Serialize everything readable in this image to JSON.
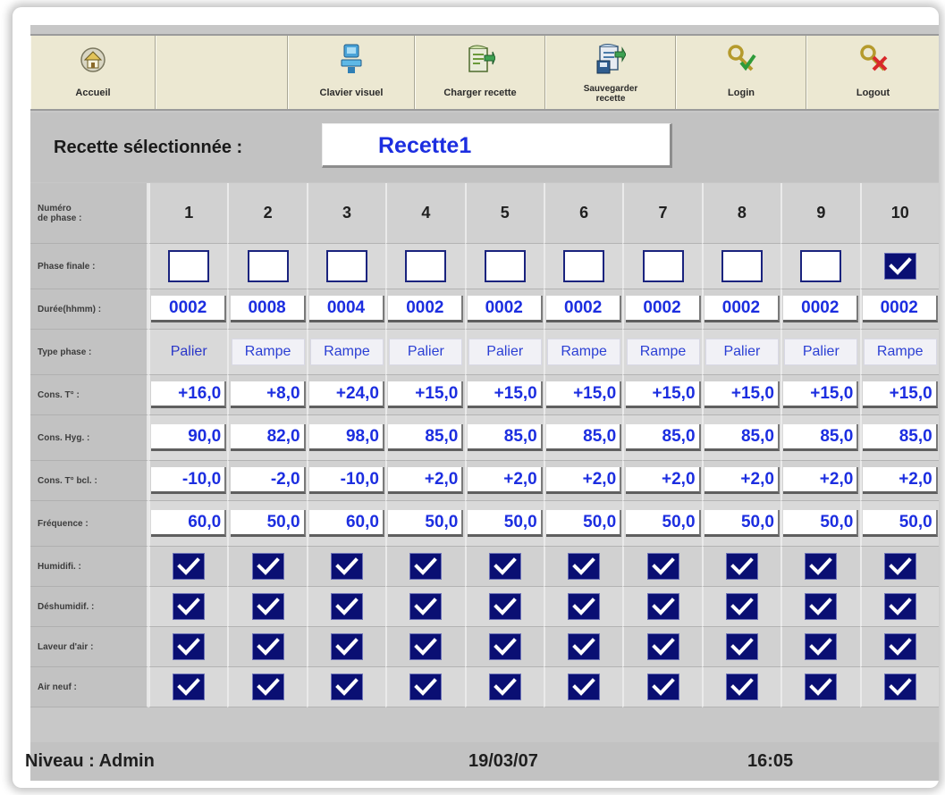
{
  "toolbar": [
    {
      "name": "home",
      "label": "Accueil",
      "icon": "home-icon"
    },
    {
      "name": "empty",
      "label": "",
      "icon": ""
    },
    {
      "name": "keyboard",
      "label": "Clavier visuel",
      "icon": "keyboard-icon"
    },
    {
      "name": "load",
      "label": "Charger recette",
      "icon": "load-recipe-icon"
    },
    {
      "name": "save",
      "label": "Sauvegarder\nrecette",
      "icon": "save-recipe-icon"
    },
    {
      "name": "login",
      "label": "Login",
      "icon": "key-icon"
    },
    {
      "name": "logout",
      "label": "Logout",
      "icon": "key-cross-icon"
    }
  ],
  "recipe": {
    "label": "Recette sélectionnée :",
    "name": "Recette1"
  },
  "row_labels": {
    "phase_number": "Numéro\nde phase :",
    "final_phase": "Phase finale :",
    "duration": "Durée(hhmm) :",
    "phase_type": "Type phase :",
    "cons_temp": "Cons. T° :",
    "cons_hyg": "Cons. Hyg. :",
    "cons_temp_bcl": "Cons. T° bcl. :",
    "frequency": "Fréquence :",
    "humidifier": "Humidifi. :",
    "dehumidifier": "Déshumidif. :",
    "air_washer": "Laveur d'air :",
    "fresh_air": "Air neuf :"
  },
  "phases": [
    {
      "num": "1",
      "final": false,
      "duration": "0002",
      "type": "Palier",
      "cons_temp": "+16,0",
      "cons_hyg": "90,0",
      "cons_temp_bcl": "-10,0",
      "frequency": "60,0",
      "humidifier": true,
      "dehumidifier": true,
      "air_washer": true,
      "fresh_air": true
    },
    {
      "num": "2",
      "final": false,
      "duration": "0008",
      "type": "Rampe",
      "cons_temp": "+8,0",
      "cons_hyg": "82,0",
      "cons_temp_bcl": "-2,0",
      "frequency": "50,0",
      "humidifier": true,
      "dehumidifier": true,
      "air_washer": true,
      "fresh_air": true
    },
    {
      "num": "3",
      "final": false,
      "duration": "0004",
      "type": "Rampe",
      "cons_temp": "+24,0",
      "cons_hyg": "98,0",
      "cons_temp_bcl": "-10,0",
      "frequency": "60,0",
      "humidifier": true,
      "dehumidifier": true,
      "air_washer": true,
      "fresh_air": true
    },
    {
      "num": "4",
      "final": false,
      "duration": "0002",
      "type": "Palier",
      "cons_temp": "+15,0",
      "cons_hyg": "85,0",
      "cons_temp_bcl": "+2,0",
      "frequency": "50,0",
      "humidifier": true,
      "dehumidifier": true,
      "air_washer": true,
      "fresh_air": true
    },
    {
      "num": "5",
      "final": false,
      "duration": "0002",
      "type": "Palier",
      "cons_temp": "+15,0",
      "cons_hyg": "85,0",
      "cons_temp_bcl": "+2,0",
      "frequency": "50,0",
      "humidifier": true,
      "dehumidifier": true,
      "air_washer": true,
      "fresh_air": true
    },
    {
      "num": "6",
      "final": false,
      "duration": "0002",
      "type": "Rampe",
      "cons_temp": "+15,0",
      "cons_hyg": "85,0",
      "cons_temp_bcl": "+2,0",
      "frequency": "50,0",
      "humidifier": true,
      "dehumidifier": true,
      "air_washer": true,
      "fresh_air": true
    },
    {
      "num": "7",
      "final": false,
      "duration": "0002",
      "type": "Rampe",
      "cons_temp": "+15,0",
      "cons_hyg": "85,0",
      "cons_temp_bcl": "+2,0",
      "frequency": "50,0",
      "humidifier": true,
      "dehumidifier": true,
      "air_washer": true,
      "fresh_air": true
    },
    {
      "num": "8",
      "final": false,
      "duration": "0002",
      "type": "Palier",
      "cons_temp": "+15,0",
      "cons_hyg": "85,0",
      "cons_temp_bcl": "+2,0",
      "frequency": "50,0",
      "humidifier": true,
      "dehumidifier": true,
      "air_washer": true,
      "fresh_air": true
    },
    {
      "num": "9",
      "final": false,
      "duration": "0002",
      "type": "Palier",
      "cons_temp": "+15,0",
      "cons_hyg": "85,0",
      "cons_temp_bcl": "+2,0",
      "frequency": "50,0",
      "humidifier": true,
      "dehumidifier": true,
      "air_washer": true,
      "fresh_air": true
    },
    {
      "num": "10",
      "final": true,
      "duration": "0002",
      "type": "Rampe",
      "cons_temp": "+15,0",
      "cons_hyg": "85,0",
      "cons_temp_bcl": "+2,0",
      "frequency": "50,0",
      "humidifier": true,
      "dehumidifier": true,
      "air_washer": true,
      "fresh_air": true
    }
  ],
  "status": {
    "level": "Niveau : Admin",
    "date": "19/03/07",
    "time": "16:05"
  },
  "colors": {
    "value_text": "#1c2ee0",
    "checkbox_fill": "#0a0f73",
    "toolbar_bg": "#ece8d2",
    "panel_bg": "#c7c7c7"
  }
}
